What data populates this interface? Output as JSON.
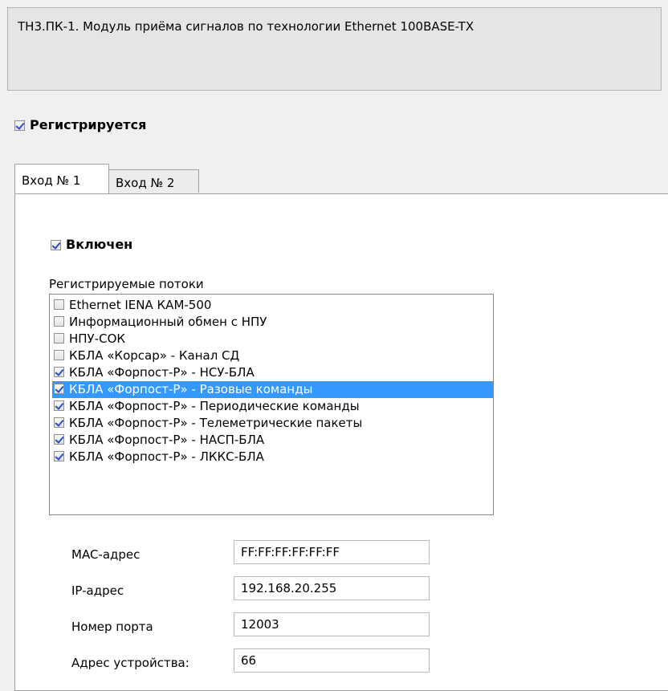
{
  "description": "ТН3.ПК-1. Модуль приёма сигналов по технологии Ethernet 100BASE-TX",
  "registered": {
    "label": "Регистрируется",
    "checked": true
  },
  "tabs": [
    {
      "label": "Вход № 1",
      "active": true
    },
    {
      "label": "Вход № 2",
      "active": false
    }
  ],
  "enabled": {
    "label": "Включен",
    "checked": true
  },
  "streams": {
    "label": "Регистрируемые потоки",
    "items": [
      {
        "label": "Ethernet IENA КАМ-500",
        "checked": false,
        "selected": false
      },
      {
        "label": "Информационный обмен с НПУ",
        "checked": false,
        "selected": false
      },
      {
        "label": "НПУ-СОК",
        "checked": false,
        "selected": false
      },
      {
        "label": "КБЛА «Корсар» - Канал СД",
        "checked": false,
        "selected": false
      },
      {
        "label": "КБЛА «Форпост-Р» - НСУ-БЛА",
        "checked": true,
        "selected": false
      },
      {
        "label": "КБЛА «Форпост-Р» - Разовые команды",
        "checked": true,
        "selected": true
      },
      {
        "label": "КБЛА «Форпост-Р» - Периодические команды",
        "checked": true,
        "selected": false
      },
      {
        "label": "КБЛА «Форпост-Р» - Телеметрические пакеты",
        "checked": true,
        "selected": false
      },
      {
        "label": "КБЛА «Форпост-Р» - НАСП-БЛА",
        "checked": true,
        "selected": false
      },
      {
        "label": "КБЛА «Форпост-Р» - ЛККС-БЛА",
        "checked": true,
        "selected": false
      }
    ]
  },
  "fields": {
    "mac": {
      "label": "MAC-адрес",
      "value": "FF:FF:FF:FF:FF:FF"
    },
    "ip": {
      "label": "IP-адрес",
      "value": "192.168.20.255"
    },
    "port": {
      "label": "Номер порта",
      "value": "12003"
    },
    "device": {
      "label": "Адрес устройства:",
      "value": "66"
    }
  },
  "colors": {
    "selection": "#3399ff",
    "check": "#2a4ec7"
  }
}
